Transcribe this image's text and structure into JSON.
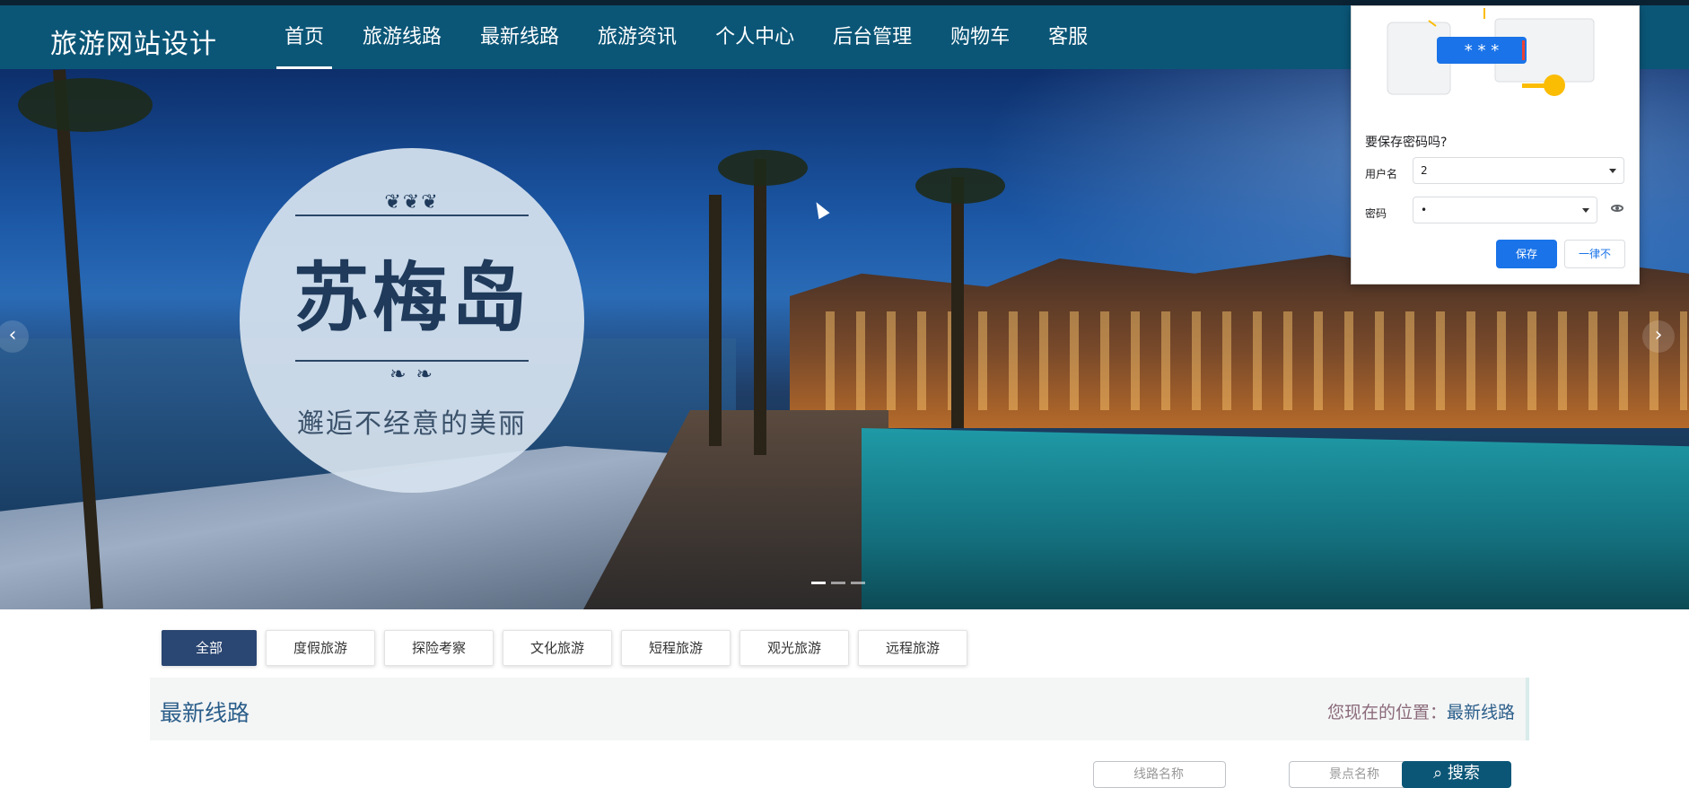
{
  "header": {
    "logo": "旅游网站设计",
    "nav": [
      {
        "label": "首页",
        "active": true
      },
      {
        "label": "旅游线路"
      },
      {
        "label": "最新线路"
      },
      {
        "label": "旅游资讯"
      },
      {
        "label": "个人中心"
      },
      {
        "label": "后台管理"
      },
      {
        "label": "购物车"
      },
      {
        "label": "客服"
      }
    ]
  },
  "banner": {
    "title": "苏梅岛",
    "subtitle": "邂逅不经意的美丽",
    "prev_icon": "chevron-left-icon",
    "next_icon": "chevron-right-icon",
    "prev_glyph": "‹",
    "next_glyph": "›",
    "slides_count": 3,
    "active_slide": 1
  },
  "categories": [
    "全部",
    "度假旅游",
    "探险考察",
    "文化旅游",
    "短程旅游",
    "观光旅游",
    "远程旅游"
  ],
  "section": {
    "title": "最新线路",
    "location_prefix": "您现在的位置：",
    "location_current": "最新线路"
  },
  "search": {
    "route_name_placeholder": "线路名称",
    "author_placeholder": "景点名称",
    "button_label": "搜索",
    "button_icon": "search-icon"
  },
  "password_popup": {
    "title": "要保存密码吗?",
    "masked_demo": "* * *",
    "username_label": "用户名",
    "username_value": "2",
    "password_label": "密码",
    "password_value": "•",
    "save_label": "保存",
    "never_label": "一律不"
  },
  "colors": {
    "header_bg": "#0b5677",
    "active_category": "#2a4672",
    "popup_button": "#1a73e8"
  }
}
